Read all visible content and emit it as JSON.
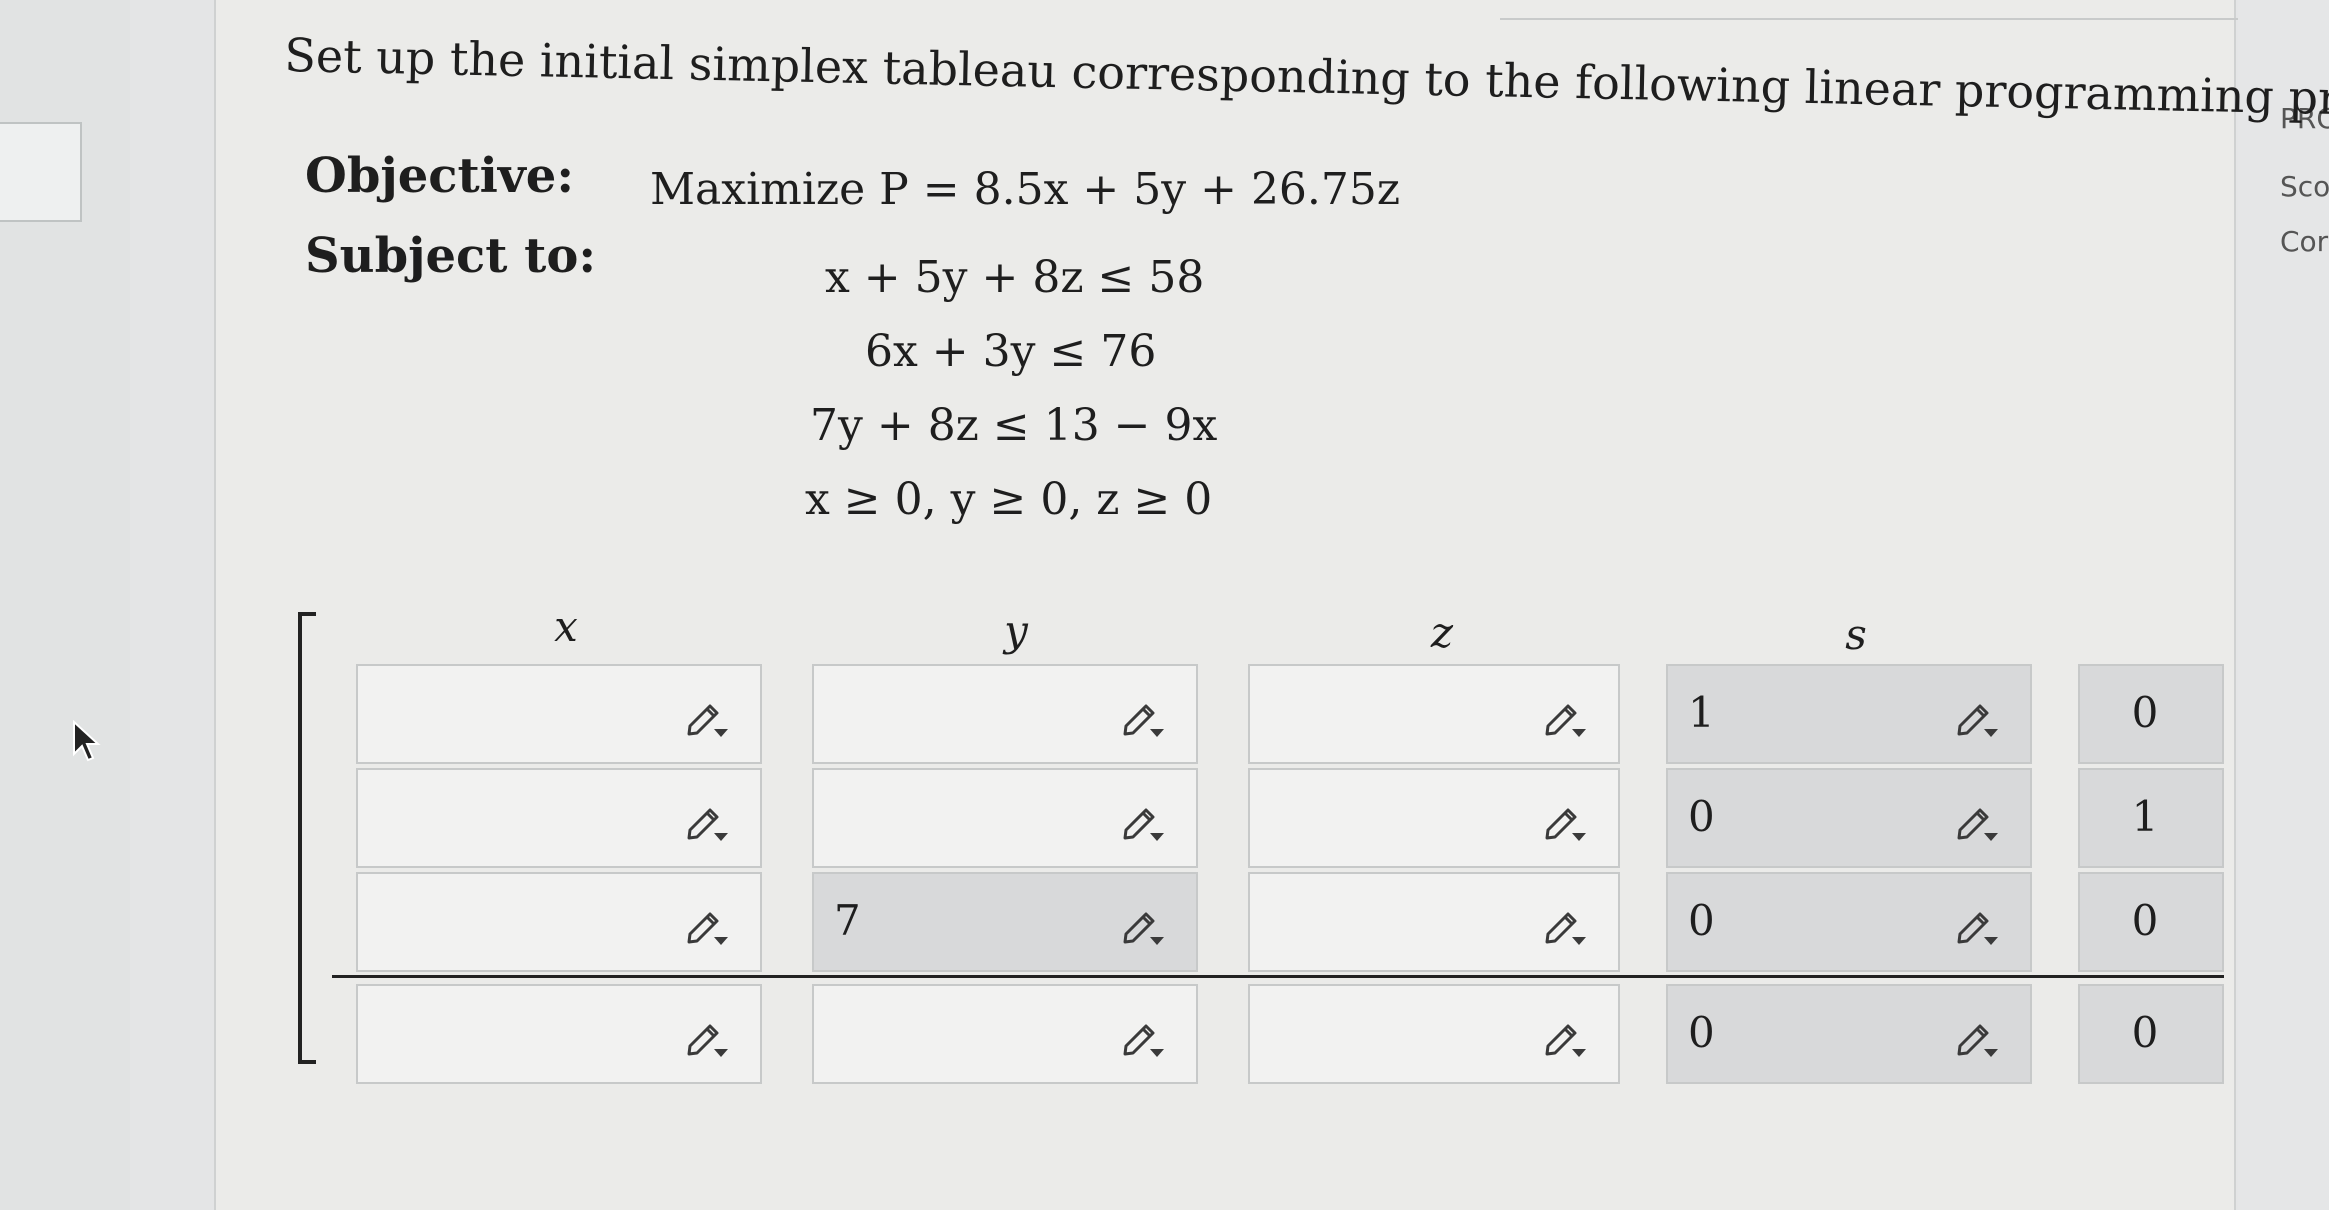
{
  "question": "Set up the initial simplex tableau corresponding to the following linear programming problem.",
  "objective_label": "Objective:",
  "subject_label": "Subject to:",
  "objective_expr": "Maximize P = 8.5x + 5y + 26.75z",
  "constraints": [
    "x + 5y + 8z ≤ 58",
    "6x + 3y ≤ 76",
    "7y + 8z ≤ 13 − 9x",
    "x ≥ 0, y ≥ 0, z ≥ 0"
  ],
  "column_headers": [
    "x",
    "y",
    "z",
    "s"
  ],
  "tableau": {
    "rows": [
      {
        "x": "",
        "y": "",
        "z": "",
        "s1": "1",
        "s2": "0"
      },
      {
        "x": "",
        "y": "",
        "z": "",
        "s1": "0",
        "s2": "1"
      },
      {
        "x": "",
        "y": "7",
        "z": "",
        "s1": "0",
        "s2": "0"
      },
      {
        "x": "",
        "y": "",
        "z": "",
        "s1": "0",
        "s2": "0"
      }
    ]
  },
  "side_panel": [
    "PRO",
    "Sco",
    "Cor"
  ],
  "icons": {
    "edit": "pencil-dropdown-icon",
    "pointer": "cursor-arrow-icon"
  },
  "colors": {
    "cell_empty": "#f2f2f1",
    "cell_filled": "#d8d9da",
    "text": "#1e1e1e"
  }
}
